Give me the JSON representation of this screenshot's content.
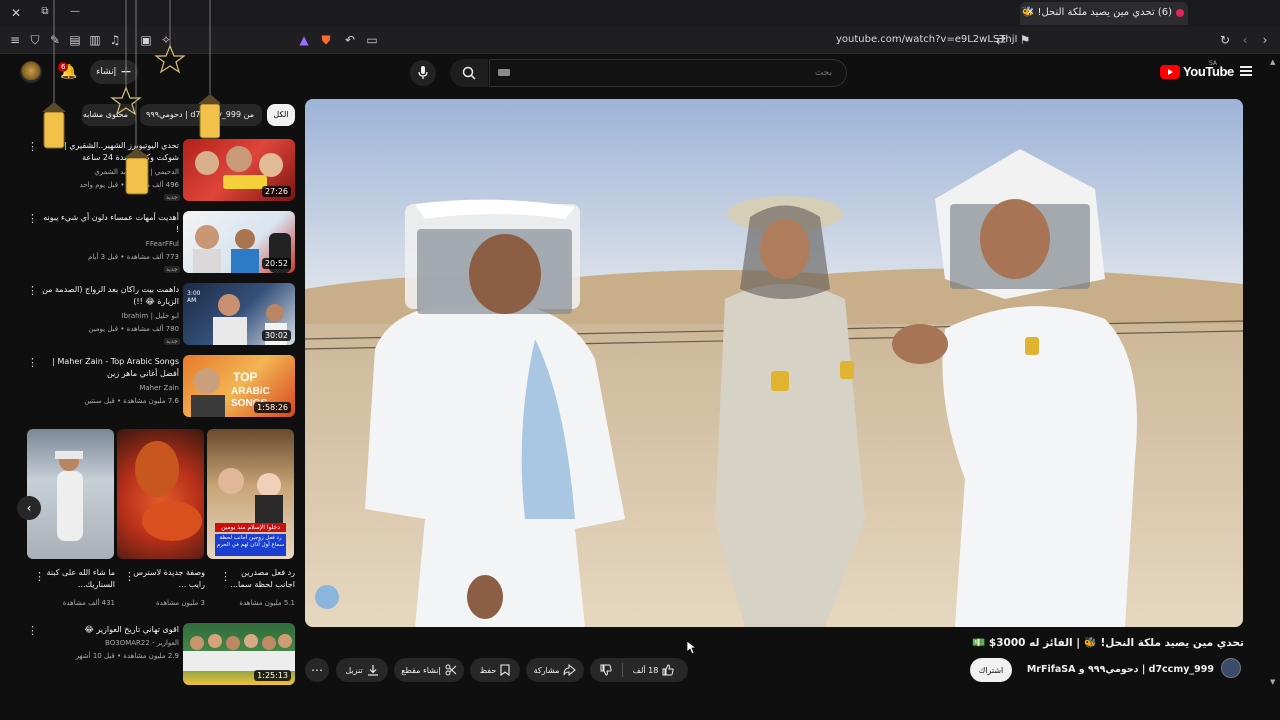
{
  "browser": {
    "tab_title": "(6) تحدي مين يصيد ملكة النحل! 🐝",
    "tab_close": "✕",
    "new_tab": "+",
    "url": "youtube.com/watch?v=e9L2wLSThjI",
    "window_close": "✕",
    "window_restore": "⧉",
    "window_minimize": "—"
  },
  "header": {
    "search_placeholder": "بحث",
    "logo_text": "YouTube",
    "country_code": "SA",
    "create_label": "إنشاء",
    "notification_count": "6"
  },
  "chips": [
    {
      "label": "الكل",
      "active": true
    },
    {
      "label": "من d7ccmy_999 | دحومي٩٩٩",
      "active": false
    },
    {
      "label": "محتوى مشابه",
      "active": false
    }
  ],
  "sidebar_videos": [
    {
      "title": "تحدي اليوتيوبرز الشهير..الشقيري | شوكت وكلون لمدة 24 ساعة",
      "channel": "الدحيمي | غالية عابد الشمري",
      "meta": "496 ألف مشاهدة • قبل يوم واحد",
      "duration": "27:26",
      "tag": "جديد"
    },
    {
      "title": "أهديت أمهات عمساء دلون أي شيء يبونه !",
      "channel": "FFearFFul",
      "meta": "773 ألف مشاهدة • قبل 3 أيام",
      "duration": "20:52",
      "tag": "جديد"
    },
    {
      "title": "داهمت بيت راكان بعد الزواج (الصدمة من الزيارة 😂 !!)",
      "channel": "ابو خليل | Ibrahim",
      "meta": "780 ألف مشاهدة • قبل يومين",
      "duration": "30:02",
      "tag": "جديد"
    },
    {
      "title": "Maher Zain - Top Arabic Songs | أفضل أغاني ماهر زين",
      "channel": "Maher Zain",
      "meta": "7.6 مليون مشاهدة • قبل سنتين",
      "duration": "1:58:26",
      "tag": ""
    },
    {
      "title": "اقوى تهاني تاريخ العوازير 😂",
      "channel": "العوازير - BO3OMAR22",
      "meta": "2.9 مليون مشاهدة • قبل 10 أشهر",
      "duration": "1:25:13",
      "tag": ""
    }
  ],
  "shorts": [
    {
      "title": "رد فعل مصدرين اجانب لحظة سما...",
      "views": "5.1 مليون مشاهدة",
      "overlay_1": "دخلوا الإسلام منذ يومين",
      "overlay_2": "رد فعل زوجين أجانب لحظة سماع أول أذان لهم في الحرم"
    },
    {
      "title": "وصفة جديدة لاسترس رايب ...",
      "views": "3 مليون مشاهدة"
    },
    {
      "title": "ما شاء الله على كبنة السناريك...",
      "views": "431 ألف مشاهدة"
    }
  ],
  "video": {
    "title": "تحدي مين يصيد ملكة النحل! 🐝 | الفائز له 3000$ 💵",
    "channel": "d7ccmy_999 | دحومي٩٩٩ و MrFifaSA",
    "subscribe_label": "اشتراك",
    "likes": "18 ألف",
    "share_label": "مشاركة",
    "save_label": "حفظ",
    "clip_label": "إنشاء مقطع",
    "download_label": "تنزيل"
  },
  "colors": {
    "background": "#0f0f0f",
    "chip": "#272727",
    "brand_red": "#ff0000",
    "text": "#f1f1f1",
    "meta_text": "#aaaaaa"
  },
  "icons": [
    "hamburger-menu-icon",
    "search-icon",
    "mic-icon",
    "bell-icon",
    "create-plus-icon",
    "like-icon",
    "dislike-icon",
    "share-icon",
    "save-icon",
    "scissors-icon",
    "download-icon",
    "more-icon",
    "verified-icon"
  ]
}
